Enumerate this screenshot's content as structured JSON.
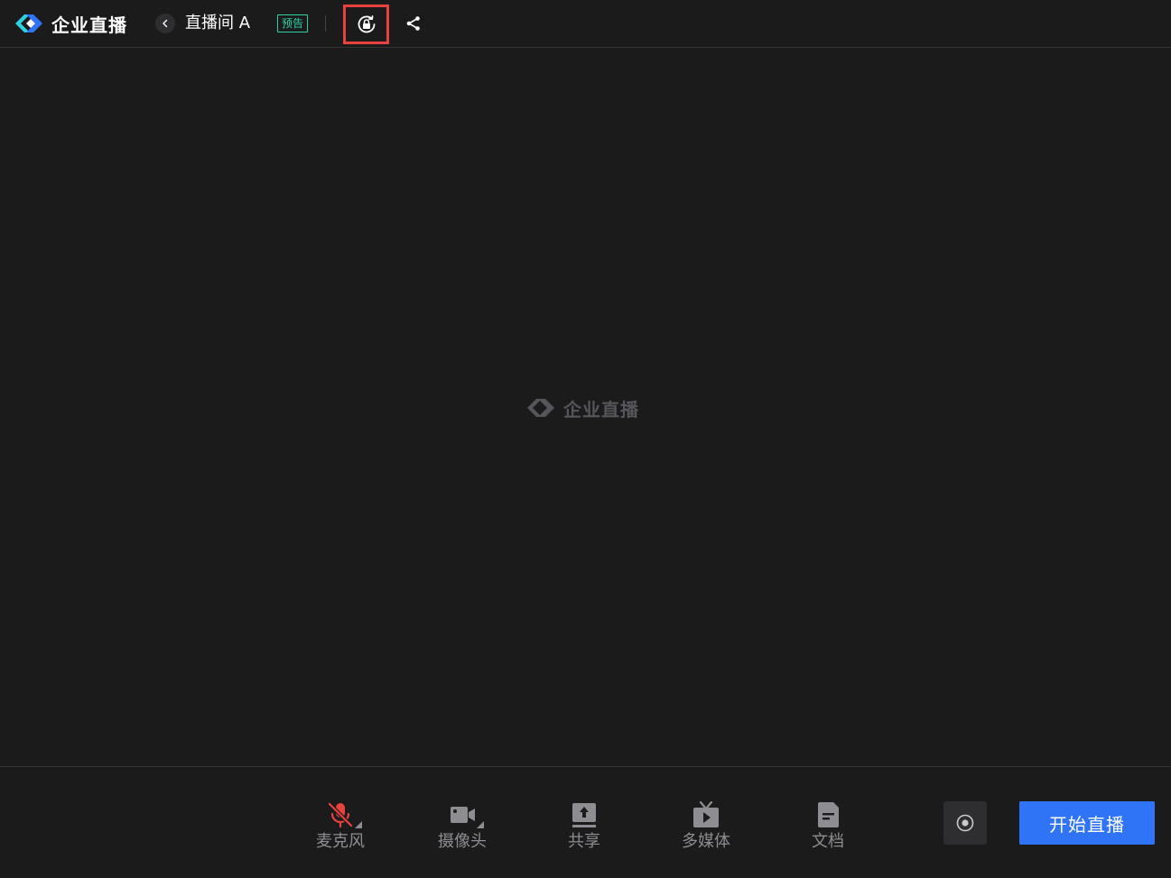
{
  "header": {
    "brand_name": "企业直播",
    "room_title": "直播间 A",
    "status_badge": "预告"
  },
  "stage": {
    "watermark_text": "企业直播"
  },
  "toolbar": {
    "tools": [
      {
        "label": "麦克风",
        "icon": "microphone-muted-icon",
        "has_dropdown": true
      },
      {
        "label": "摄像头",
        "icon": "camera-icon",
        "has_dropdown": true
      },
      {
        "label": "共享",
        "icon": "screen-share-icon",
        "has_dropdown": false
      },
      {
        "label": "多媒体",
        "icon": "multimedia-icon",
        "has_dropdown": false
      },
      {
        "label": "文档",
        "icon": "document-icon",
        "has_dropdown": false
      }
    ],
    "start_label": "开始直播"
  },
  "colors": {
    "background": "#1b1b1c",
    "accent": "#2f74f6",
    "badge": "#2fd1a3",
    "mic_muted": "#e8423f",
    "highlight_border": "#e8423f",
    "muted_text": "#8d8d92"
  }
}
